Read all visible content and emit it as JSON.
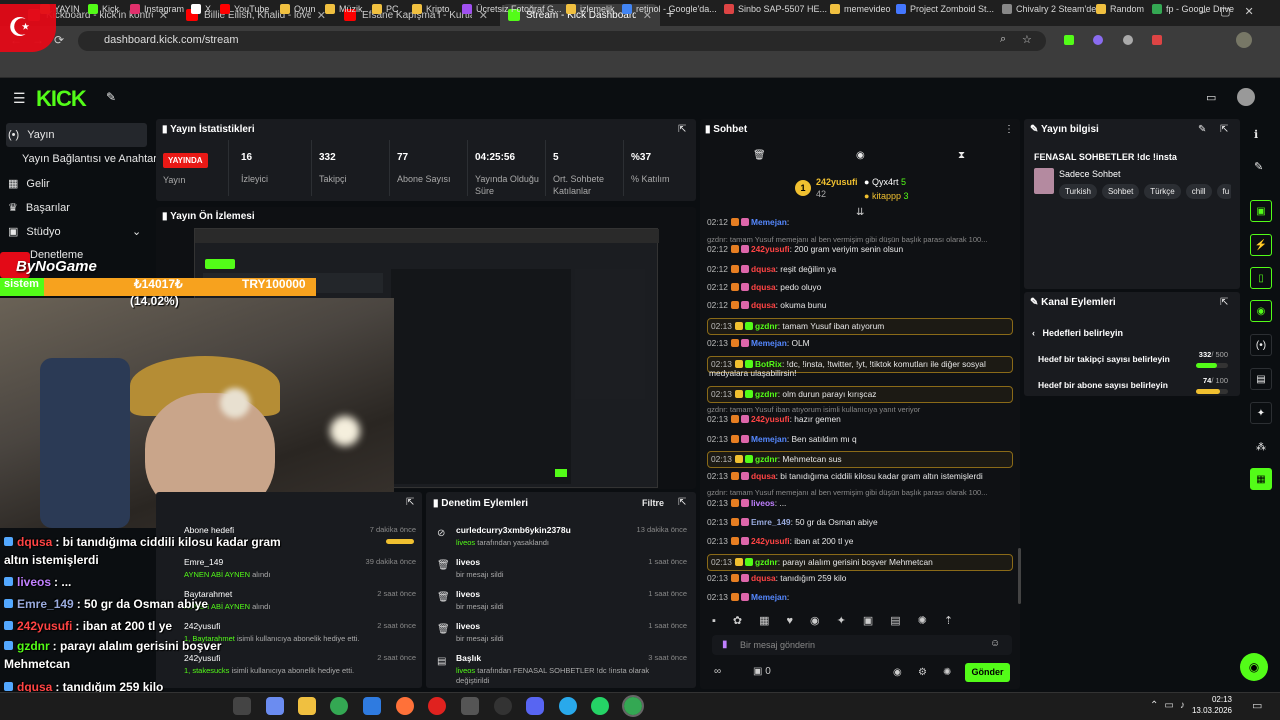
{
  "browser": {
    "tabs": [
      {
        "title": "Kickboard - kick'in kontrol paneli",
        "color": "#e04040"
      },
      {
        "title": "Billie Eilish, Khalid - lovely",
        "color": "#ff0000"
      },
      {
        "title": "Efsane Kapışma l - Kurtlar Vadisi",
        "color": "#ff0000"
      },
      {
        "title": "Stream - Kick Dashboard",
        "color": "#53fc18"
      }
    ],
    "url": "dashboard.kick.com/stream",
    "bookmarks": [
      "YAYIN",
      "Kick",
      "Instagram",
      "X",
      "YouTube",
      "Oyun",
      "Müzik",
      "PC",
      "Kripto",
      "Ücretsiz Fotoğraf G...",
      "izlemelik",
      "retinol - Google'da...",
      "Sinbo SAP-5507 HE...",
      "memevideo",
      "Project Zomboid St...",
      "Chivalry 2 Steam'de",
      "Random",
      "fp - Google Drive"
    ]
  },
  "kick": {
    "logo": "KICK"
  },
  "sidebar": {
    "items": [
      "Yayın",
      "Yayın Bağlantısı ve Anahtarı",
      "Gelir",
      "Başarılar",
      "Stüdyo",
      "Denetleme"
    ]
  },
  "stats": {
    "title": "Yayın İstatistikleri",
    "live_badge": "YAYINDA",
    "live_label": "Yayın",
    "items": [
      {
        "value": "16",
        "label": "İzleyici"
      },
      {
        "value": "332",
        "label": "Takipçi"
      },
      {
        "value": "77",
        "label": "Abone Sayısı"
      },
      {
        "value": "04:25:56",
        "label": "Yayında Olduğu Süre"
      },
      {
        "value": "5",
        "label": "Ort. Sohbete Katılanlar"
      },
      {
        "value": "%37",
        "label": "% Katılım"
      }
    ]
  },
  "preview": {
    "title": "Yayın Ön İzlemesi"
  },
  "overlay": {
    "brand": "ByNoGame",
    "goal_label": "sistem",
    "goal_amount": "₺14017₺",
    "goal_target": "TRY100000",
    "goal_percent": "(14.02%)",
    "goal_fraction": 0.1402,
    "chat": [
      {
        "user": "dqusa",
        "color": "#ff4444",
        "text": ": bi tanıdığıma ciddili kilosu kadar gram"
      },
      {
        "user": "",
        "color": "#fff",
        "text": "altın istemişlerdi"
      },
      {
        "user": "liveos",
        "color": "#c080ff",
        "text": ": ..."
      },
      {
        "user": "Emre_149",
        "color": "#9ad",
        "text": ": 50 gr da Osman abiye"
      },
      {
        "user": "242yusufi",
        "color": "#ff4444",
        "text": ": iban at 200 tl ye"
      },
      {
        "user": "gzdnr",
        "color": "#53fc18",
        "text": ": parayı alalım gerisini boşver"
      },
      {
        "user": "",
        "color": "#fff",
        "text": "Mehmetcan"
      },
      {
        "user": "dqusa",
        "color": "#ff4444",
        "text": ": tanıdığım 259 kilo"
      },
      {
        "user": "Memejan",
        "color": "#5588ff",
        "text": ":"
      }
    ]
  },
  "activity": {
    "items": [
      {
        "name": "Abone hedefi",
        "sub": "",
        "time": "7 dakika önce"
      },
      {
        "name": "Emre_149",
        "sub": "AYNEN ABİ AYNEN",
        "sub2": "alındı",
        "time": "39 dakika önce"
      },
      {
        "name": "Baytarahmet",
        "sub": "AYNEN ABİ AYNEN",
        "sub2": "alındı",
        "time": "2 saat önce"
      },
      {
        "name": "242yusufi",
        "sub": "1, Baytarahmet",
        "sub2": "isimli kullanıcıya abonelik hediye etti.",
        "time": "2 saat önce"
      },
      {
        "name": "242yusufi",
        "sub": "1, stakesucks",
        "sub2": "isimli kullanıcıya abonelik hediye etti.",
        "time": "2 saat önce"
      }
    ]
  },
  "moderation": {
    "title": "Denetim Eylemleri",
    "filter": "Filtre",
    "items": [
      {
        "name": "curledcurry3xmb6ykin2378u",
        "sub_user": "liveos",
        "sub": "tarafından yasaklandı",
        "time": "13 dakika önce"
      },
      {
        "name": "liveos",
        "sub_user": "",
        "sub": "bir mesajı sildi",
        "time": "1 saat önce"
      },
      {
        "name": "liveos",
        "sub_user": "",
        "sub": "bir mesajı sildi",
        "time": "1 saat önce"
      },
      {
        "name": "liveos",
        "sub_user": "",
        "sub": "bir mesajı sildi",
        "time": "1 saat önce"
      },
      {
        "name": "Başlık",
        "sub_user": "liveos",
        "sub": "tarafından FENASAL SOHBETLER !dc !insta olarak değiştirildi",
        "time": "3 saat önce"
      }
    ]
  },
  "chat": {
    "title": "Sohbet",
    "pinned": {
      "user1": "242yusufi",
      "count1": "42",
      "user2": "Qyx4rt",
      "count2": "5",
      "user3": "kitappp",
      "count3": "3"
    },
    "messages": [
      {
        "time": "02:12",
        "user": "Memejan",
        "color": "#5588ff",
        "text": ":",
        "hl": false
      },
      {
        "time": "",
        "user": "",
        "color": "#888",
        "text": "gzdnr: tamam Yusuf memejanı al ben vermişim gibi düşün başlık parası olarak 100...",
        "hl": false,
        "reply": true
      },
      {
        "time": "02:12",
        "user": "242yusufi",
        "color": "#ff4444",
        "text": ": 200 gram veriyim senin olsun",
        "hl": false
      },
      {
        "time": "02:12",
        "user": "dqusa",
        "color": "#ff4444",
        "text": ": reşit değilim ya",
        "hl": false
      },
      {
        "time": "02:12",
        "user": "dqusa",
        "color": "#ff4444",
        "text": ": pedo oluyo",
        "hl": false
      },
      {
        "time": "02:12",
        "user": "dqusa",
        "color": "#ff4444",
        "text": ": okuma bunu",
        "hl": false
      },
      {
        "time": "02:13",
        "user": "gzdnr",
        "color": "#53fc18",
        "text": ": tamam Yusuf iban atıyorum",
        "hl": true
      },
      {
        "time": "02:13",
        "user": "Memejan",
        "color": "#5588ff",
        "text": ": OLM",
        "hl": false
      },
      {
        "time": "02:13",
        "user": "BotRix",
        "color": "#53fc18",
        "text": ": !dc, !insta, !twitter, !yt, !tiktok komutları ile diğer sosyal",
        "hl": true
      },
      {
        "time": "",
        "user": "",
        "color": "#e8e8e8",
        "text": "medyalara ulaşabilirsin!",
        "hl": false
      },
      {
        "time": "02:13",
        "user": "gzdnr",
        "color": "#53fc18",
        "text": ": olm durun parayı kırışcaz",
        "hl": true
      },
      {
        "time": "",
        "user": "",
        "color": "#888",
        "text": "gzdnr: tamam Yusuf iban atıyorum isimli kullanıcıya yanıt veriyor",
        "hl": false,
        "reply": true
      },
      {
        "time": "02:13",
        "user": "242yusufi",
        "color": "#ff4444",
        "text": ": hazır gemen",
        "hl": false
      },
      {
        "time": "02:13",
        "user": "Memejan",
        "color": "#5588ff",
        "text": ": Ben satıldım mı q",
        "hl": false
      },
      {
        "time": "02:13",
        "user": "gzdnr",
        "color": "#53fc18",
        "text": ": Mehmetcan sus",
        "hl": true
      },
      {
        "time": "02:13",
        "user": "dqusa",
        "color": "#ff4444",
        "text": ": bi tanıdığıma ciddili kilosu kadar gram altın istemişlerdi",
        "hl": false
      },
      {
        "time": "",
        "user": "",
        "color": "#888",
        "text": "gzdnr: tamam Yusuf memejanı al ben vermişim gibi düşün başlık parası olarak 100...",
        "hl": false,
        "reply": true
      },
      {
        "time": "02:13",
        "user": "liveos",
        "color": "#c080ff",
        "text": ": ...",
        "hl": false
      },
      {
        "time": "02:13",
        "user": "Emre_149",
        "color": "#99aadd",
        "text": ": 50 gr da Osman abiye",
        "hl": false
      },
      {
        "time": "02:13",
        "user": "242yusufi",
        "color": "#ff4444",
        "text": ": iban at 200 tl ye",
        "hl": false
      },
      {
        "time": "02:13",
        "user": "gzdnr",
        "color": "#53fc18",
        "text": ": parayı alalım gerisini boşver Mehmetcan",
        "hl": true
      },
      {
        "time": "02:13",
        "user": "dqusa",
        "color": "#ff4444",
        "text": ": tanıdığım 259 kilo",
        "hl": false
      },
      {
        "time": "02:13",
        "user": "Memejan",
        "color": "#5588ff",
        "text": ":",
        "hl": false
      }
    ],
    "input_placeholder": "Bir mesaj gönderin",
    "viewer_count": "0",
    "send": "Gönder"
  },
  "info": {
    "title": "Yayın bilgisi",
    "stream_title": "FENASAL SOHBETLER !dc !insta",
    "category": "Sadece Sohbet",
    "tags": [
      "Turkish",
      "Sohbet",
      "Türkçe",
      "chill",
      "fu"
    ]
  },
  "actions": {
    "title": "Kanal Eylemleri",
    "back": "Hedefleri belirleyin",
    "goals": [
      {
        "label": "Hedef bir takipçi sayısı belirleyin",
        "current": "332",
        "target": "/ 500",
        "fraction": 0.664,
        "color": "#53fc18"
      },
      {
        "label": "Hedef bir abone sayısı belirleyin",
        "current": "74",
        "target": "/ 100",
        "fraction": 0.74,
        "color": "#f0c030"
      }
    ]
  },
  "taskbar": {
    "time": "02:13",
    "date": "13.03.2026"
  }
}
